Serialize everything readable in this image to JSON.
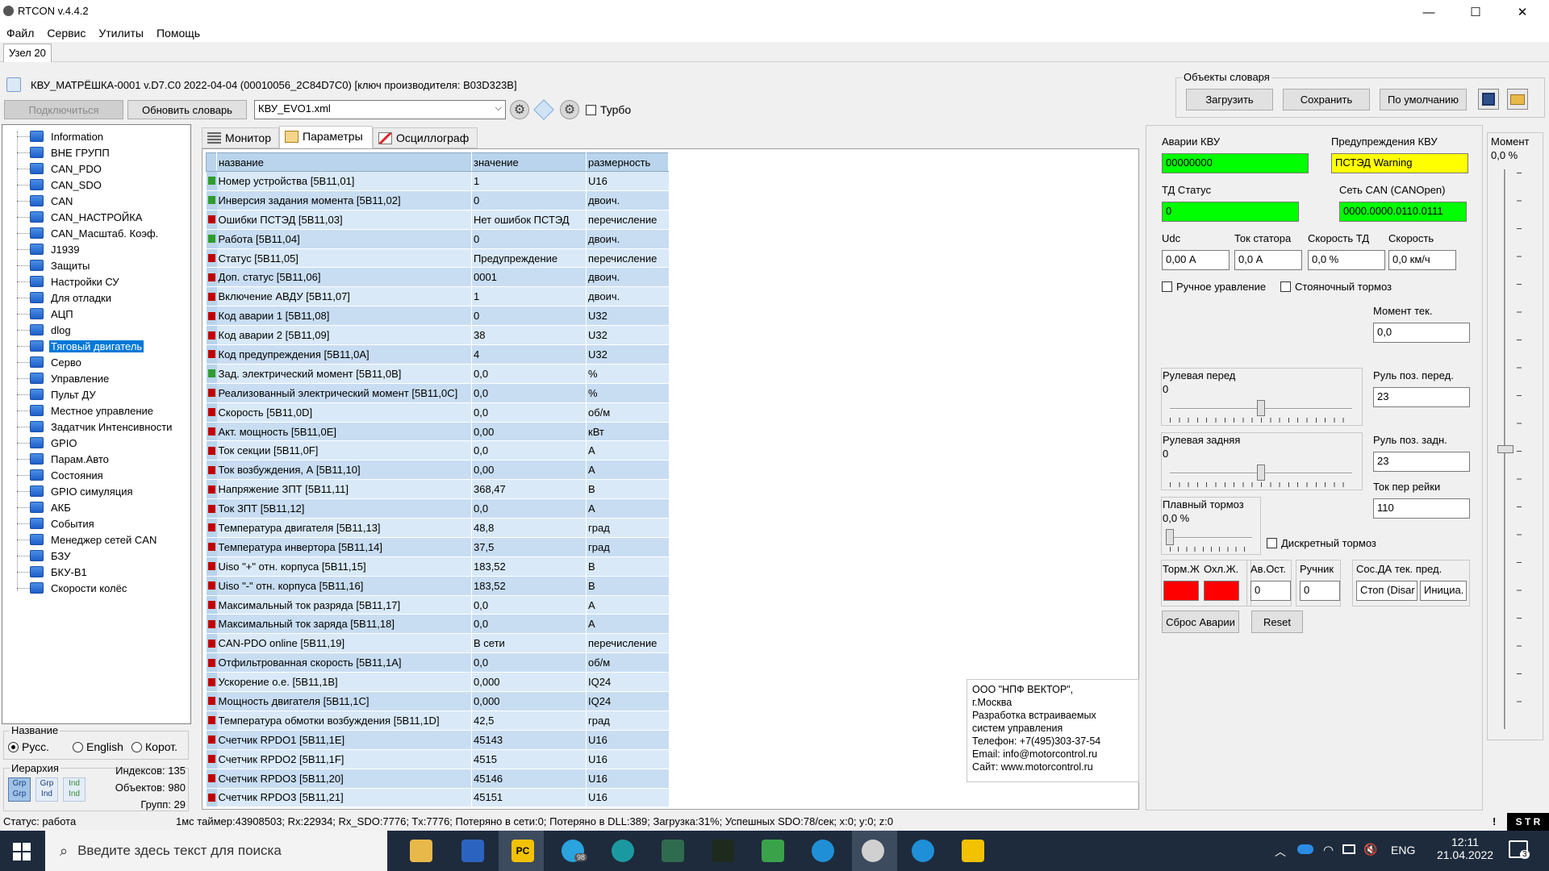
{
  "window": {
    "title": "RTCON v.4.4.2",
    "minimize": "—",
    "maximize": "☐",
    "close": "✕"
  },
  "menu": [
    "Файл",
    "Сервис",
    "Утилиты",
    "Помощь"
  ],
  "node_tab": "Узел 20",
  "device_info": "КВУ_МАТРЁШКА-0001  v.D7.C0  2022-04-04 (00010056_2C84D7C0) [ключ производителя: B03D323B]",
  "toolbar": {
    "connect": "Подключиться",
    "refresh_dict": "Обновить словарь",
    "dict_file": "КВУ_EVO1.xml",
    "turbo": "Турбо"
  },
  "dict_objects": {
    "title": "Объекты словаря",
    "load": "Загрузить",
    "save": "Сохранить",
    "default": "По умолчанию"
  },
  "tree": [
    "Information",
    "ВНЕ ГРУПП",
    "CAN_PDO",
    "CAN_SDO",
    "CAN",
    "CAN_НАСТРОЙКА",
    "CAN_Масштаб. Коэф.",
    "J1939",
    "Защиты",
    "Настройки СУ",
    "Для отладки",
    "АЦП",
    "dlog",
    "Тяговый двигатель",
    "Серво",
    "Управление",
    "Пульт ДУ",
    "Местное управление",
    "Задатчик Интенсивности",
    "GPIO",
    "Парам.Авто",
    "Состояния",
    "GPIO симуляция",
    "АКБ",
    "События",
    "Менеджер сетей CAN",
    "БЗУ",
    "БКУ-В1",
    "Скорости колёс"
  ],
  "selected_tree_item": "Тяговый двигатель",
  "name_group": {
    "title": "Название",
    "rus": "Русс.",
    "eng": "English",
    "short": "Корот."
  },
  "hierarchy": {
    "title": "Иерархия",
    "indexes_label": "Индексов:",
    "indexes": "135",
    "objects_label": "Объектов:",
    "objects": "980",
    "groups_label": "Групп:",
    "groups": "29"
  },
  "param_tabs": [
    "Монитор",
    "Параметры",
    "Осциллограф"
  ],
  "grid": {
    "headers": [
      "название",
      "значение",
      "размерность"
    ],
    "rows": [
      {
        "m": "green",
        "n": "Номер устройства [5B11,01]",
        "v": "1",
        "u": "U16"
      },
      {
        "m": "green",
        "n": "Инверсия задания момента [5B11,02]",
        "v": "0",
        "u": "двоич."
      },
      {
        "m": "red",
        "n": "Ошибки ПСТЭД [5B11,03]",
        "v": "Нет ошибок ПСТЭД",
        "u": "перечисление"
      },
      {
        "m": "green",
        "n": "Работа [5B11,04]",
        "v": "0",
        "u": "двоич."
      },
      {
        "m": "red",
        "n": "Статус [5B11,05]",
        "v": "Предупреждение",
        "u": "перечисление"
      },
      {
        "m": "red",
        "n": "Доп. статус [5B11,06]",
        "v": "0001",
        "u": "двоич."
      },
      {
        "m": "red",
        "n": "Включение АВДУ [5B11,07]",
        "v": "1",
        "u": "двоич."
      },
      {
        "m": "red",
        "n": "Код аварии 1 [5B11,08]",
        "v": "0",
        "u": "U32"
      },
      {
        "m": "red",
        "n": "Код аварии 2 [5B11,09]",
        "v": "38",
        "u": "U32"
      },
      {
        "m": "red",
        "n": "Код предупреждения [5B11,0A]",
        "v": "4",
        "u": "U32"
      },
      {
        "m": "green",
        "n": "Зад. электрический момент [5B11,0B]",
        "v": "0,0",
        "u": "%"
      },
      {
        "m": "red",
        "n": "Реализованный электрический момент [5B11,0C]",
        "v": "0,0",
        "u": "%"
      },
      {
        "m": "red",
        "n": "Скорость [5B11,0D]",
        "v": "0,0",
        "u": "об/м"
      },
      {
        "m": "red",
        "n": "Акт. мощность [5B11,0E]",
        "v": "0,00",
        "u": "кВт"
      },
      {
        "m": "red",
        "n": "Ток секции [5B11,0F]",
        "v": "0,0",
        "u": "А"
      },
      {
        "m": "red",
        "n": "Ток возбуждения, А [5B11,10]",
        "v": "0,00",
        "u": "А"
      },
      {
        "m": "red",
        "n": "Напряжение ЗПТ [5B11,11]",
        "v": "368,47",
        "u": "В"
      },
      {
        "m": "red",
        "n": "Ток ЗПТ [5B11,12]",
        "v": "0,0",
        "u": "А"
      },
      {
        "m": "red",
        "n": "Температура двигателя [5B11,13]",
        "v": "48,8",
        "u": "град"
      },
      {
        "m": "red",
        "n": "Температура инвертора [5B11,14]",
        "v": "37,5",
        "u": "град"
      },
      {
        "m": "red",
        "n": "Uiso \"+\" отн. корпуса [5B11,15]",
        "v": "183,52",
        "u": "В"
      },
      {
        "m": "red",
        "n": "Uiso \"-\" отн. корпуса [5B11,16]",
        "v": "183,52",
        "u": "В"
      },
      {
        "m": "red",
        "n": "Максимальный ток разряда [5B11,17]",
        "v": "0,0",
        "u": "А"
      },
      {
        "m": "red",
        "n": "Максимальный ток заряда [5B11,18]",
        "v": "0,0",
        "u": "А"
      },
      {
        "m": "red",
        "n": "CAN-PDO online [5B11,19]",
        "v": "В сети",
        "u": "перечисление"
      },
      {
        "m": "red",
        "n": "Отфильтрованная скорость [5B11,1A]",
        "v": "0,0",
        "u": "об/м"
      },
      {
        "m": "red",
        "n": "Ускорение о.е. [5B11,1B]",
        "v": "0,000",
        "u": "IQ24"
      },
      {
        "m": "red",
        "n": "Мощность двигателя [5B11,1C]",
        "v": "0,000",
        "u": "IQ24"
      },
      {
        "m": "red",
        "n": "Температура обмотки возбуждения [5B11,1D]",
        "v": "42,5",
        "u": "град"
      },
      {
        "m": "red",
        "n": "Счетчик RPDO1 [5B11,1E]",
        "v": "45143",
        "u": "U16"
      },
      {
        "m": "red",
        "n": "Счетчик RPDO2 [5B11,1F]",
        "v": "4515",
        "u": "U16"
      },
      {
        "m": "red",
        "n": "Счетчик RPDO3 [5B11,20]",
        "v": "45146",
        "u": "U16"
      },
      {
        "m": "red",
        "n": "Счетчик RPDO3 [5B11,21]",
        "v": "45151",
        "u": "U16"
      }
    ]
  },
  "vendor": [
    "ООО \"НПФ ВЕКТОР\",",
    "г.Москва",
    "Разработка встраиваемых",
    "систем управления",
    "Телефон: +7(495)303-37-54",
    "Email: info@motorcontrol.ru",
    "Сайт: www.motorcontrol.ru"
  ],
  "right": {
    "alarms_label": "Аварии КВУ",
    "alarms_value": "00000000",
    "warnings_label": "Предупреждения КВУ",
    "warnings_value": "ПСТЭД Warning",
    "td_status_label": "ТД Статус",
    "td_status_value": "0",
    "can_net_label": "Сеть CAN (CANOpen)",
    "can_net_value": "0000.0000.0110.0111",
    "udc_label": "Udc",
    "udc_value": "0,00 А",
    "stator_label": "Ток статора",
    "stator_value": "0,0 А",
    "td_speed_label": "Скорость ТД",
    "td_speed_value": "0,0 %",
    "speed_label": "Скорость",
    "speed_value": "0,0 км/ч",
    "manual_ctrl": "Ручное уравление",
    "parking_brake": "Стояночный тормоз",
    "moment_cur_label": "Момент тек.",
    "moment_cur_value": "0,0",
    "steer_front_label": "Рулевая перед",
    "steer_front_value": "0",
    "steer_front_pos_label": "Руль поз. перед.",
    "steer_front_pos_value": "23",
    "steer_rear_label": "Рулевая задняя",
    "steer_rear_value": "0",
    "steer_rear_pos_label": "Руль поз. задн.",
    "steer_rear_pos_value": "23",
    "rake_current_label": "Ток пер рейки",
    "rake_current_value": "110",
    "smooth_brake_label": "Плавный тормоз",
    "smooth_brake_value": "0,0 %",
    "discrete_brake": "Дискретный тормоз",
    "brake_label": "Торм.Ж",
    "cool_label": "Охл.Ж.",
    "emerg_stop_label": "Ав.Ост.",
    "emerg_stop_value": "0",
    "handbrake_label": "Ручник",
    "handbrake_value": "0",
    "da_state_label": "Сос.ДА тек. пред.",
    "da_stop_value": "Стоп (Disar",
    "da_init_value": "Инициа.",
    "reset_alarms": "Сброс Аварии",
    "reset": "Reset",
    "moment_label": "Момент",
    "moment_value": "0,0 %"
  },
  "sliders": {
    "steer_front": 0.5,
    "steer_rear": 0.5,
    "smooth_brake": 0.0,
    "moment": 0.5
  },
  "status": {
    "left": "Статус: работа",
    "main": "1мс таймер:43908503; Rx:22934; Rx_SDO:7776; Tx:7776; Потеряно в сети:0; Потеряно в DLL:389; Загрузка:31%; Успешных SDO:78/сек; x:0; y:0; z:0",
    "excl": "!",
    "str": "S T R"
  },
  "taskbar": {
    "search_placeholder": "Введите здесь текст для поиска",
    "lang": "ENG",
    "time": "12:11",
    "date": "21.04.2022",
    "notif_count": "3",
    "telegram_badge": "98"
  },
  "colors": {
    "accent": "#0078d7",
    "ok": "#00ff00",
    "warn": "#ffff00",
    "alarm": "#ff0000",
    "taskbar": "#1e2b3c"
  }
}
